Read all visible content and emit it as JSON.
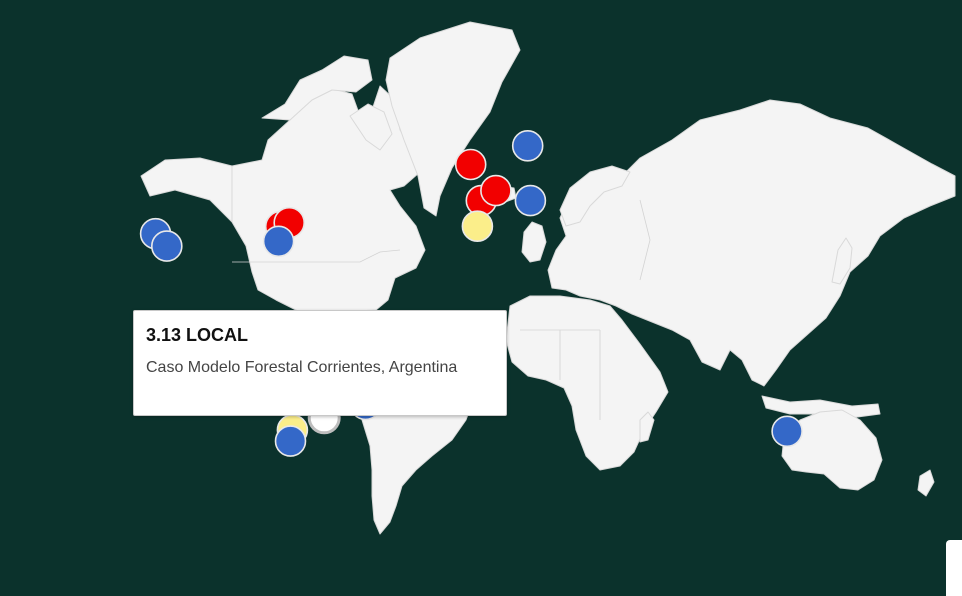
{
  "map": {
    "background_color": "#0b322c",
    "land_color": "#f4f4f4",
    "border_color": "#d3d3d3"
  },
  "legend_colors": {
    "blue": "#3468c8",
    "red": "#f20000",
    "yellow": "#fbee8a",
    "white": "#ffffff"
  },
  "markers": [
    {
      "id": "m1",
      "lon": -122.4,
      "lat": 37.8,
      "color": "blue"
    },
    {
      "id": "m2",
      "lon": -118.2,
      "lat": 34.0,
      "color": "blue"
    },
    {
      "id": "m3",
      "lon": -75.2,
      "lat": 39.9,
      "color": "red"
    },
    {
      "id": "m4",
      "lon": -72.0,
      "lat": 41.0,
      "color": "red"
    },
    {
      "id": "m5",
      "lon": -76.0,
      "lat": 35.5,
      "color": "blue"
    },
    {
      "id": "m6",
      "lon": -3.5,
      "lat": 55.5,
      "color": "red"
    },
    {
      "id": "m7",
      "lon": 18.0,
      "lat": 59.3,
      "color": "blue"
    },
    {
      "id": "m8",
      "lon": 0.5,
      "lat": 47.0,
      "color": "red"
    },
    {
      "id": "m9",
      "lon": 6.0,
      "lat": 49.5,
      "color": "red"
    },
    {
      "id": "m10",
      "lon": 19.0,
      "lat": 47.0,
      "color": "blue"
    },
    {
      "id": "m11",
      "lon": -1.0,
      "lat": 40.0,
      "color": "yellow"
    },
    {
      "id": "m12",
      "lon": 115.9,
      "lat": -31.9,
      "color": "blue"
    },
    {
      "id": "m13",
      "lon": -76.0,
      "lat": -12.0,
      "color": "red"
    },
    {
      "id": "m14",
      "lon": -63.0,
      "lat": -17.5,
      "color": "blue"
    },
    {
      "id": "m15",
      "lon": -43.2,
      "lat": -22.9,
      "color": "blue"
    },
    {
      "id": "m16",
      "lon": -70.8,
      "lat": -31.5,
      "color": "yellow"
    },
    {
      "id": "m17",
      "lon": -71.5,
      "lat": -35.0,
      "color": "blue"
    },
    {
      "id": "m18",
      "lon": -58.8,
      "lat": -27.5,
      "color": "white",
      "selected": true
    }
  ],
  "tooltip": {
    "title": "3.13 LOCAL",
    "description": "Caso Modelo Forestal Corrientes, Argentina"
  }
}
